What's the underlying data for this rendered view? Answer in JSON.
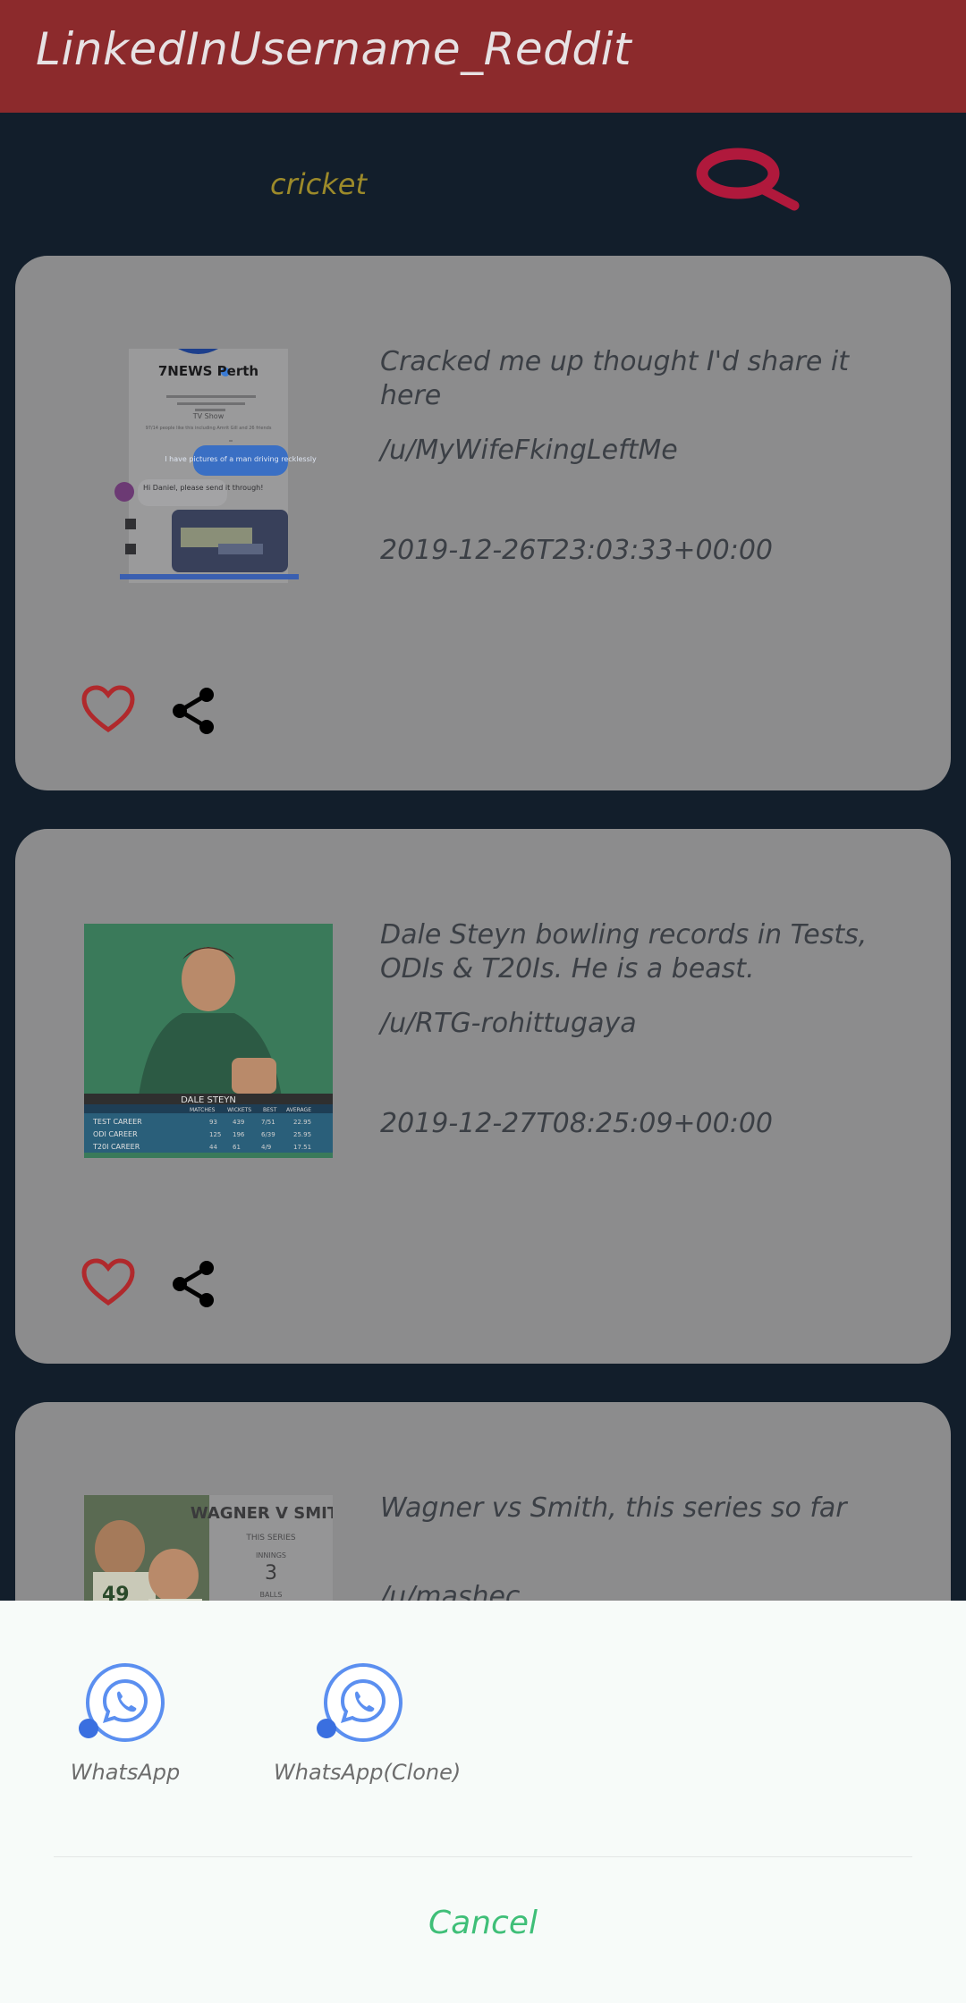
{
  "app": {
    "title": "LinkedInUsername_Reddit"
  },
  "search": {
    "value": "cricket",
    "icon": "search-icon"
  },
  "posts": [
    {
      "title": "Cracked me up thought I'd share it here",
      "author": "/u/MyWifeFkingLeftMe",
      "date": "2019-12-26T23:03:33+00:00",
      "thumbnail": {
        "page_name": "7NEWS Perth",
        "likes": "97/14 people like this including Amrit Gill and 26 friends",
        "category": "TV Show",
        "bubble_text": "I have pictures of a man driving recklessly",
        "reply_text": "Hi Daniel, please send it through!"
      }
    },
    {
      "title": "Dale Steyn bowling records in Tests, ODIs & T20Is. He is a beast.",
      "author": "/u/RTG-rohittugaya",
      "date": "2019-12-27T08:25:09+00:00",
      "thumbnail": {
        "name": "DALE STEYN",
        "headers": [
          "MATCHES",
          "WICKETS",
          "BEST",
          "AVERAGE"
        ],
        "rows": [
          [
            "TEST CAREER",
            "93",
            "439",
            "7/51",
            "22.95"
          ],
          [
            "ODI CAREER",
            "125",
            "196",
            "6/39",
            "25.95"
          ],
          [
            "T20I CAREER",
            "44",
            "61",
            "4/9",
            "17.51"
          ]
        ]
      }
    },
    {
      "title": "Wagner vs Smith, this series so far",
      "author": "/u/mashec",
      "date": "",
      "thumbnail": {
        "name": "WAGNER V SMITH",
        "subtitle": "THIS SERIES",
        "innings_label": "INNINGS",
        "innings": "3",
        "balls_label": "BALLS",
        "jersey": "49"
      }
    }
  ],
  "share_sheet": {
    "options": [
      {
        "label": "WhatsApp",
        "icon": "whatsapp-icon"
      },
      {
        "label": "WhatsApp(Clone)",
        "icon": "whatsapp-clone-icon"
      }
    ],
    "cancel_label": "Cancel"
  },
  "colors": {
    "appbar": "#8c2a2c",
    "background": "#121e2b",
    "card": "#8c8c8d",
    "search_icon": "#b0193c",
    "like": "#b0292c",
    "cancel": "#3fbf78"
  }
}
